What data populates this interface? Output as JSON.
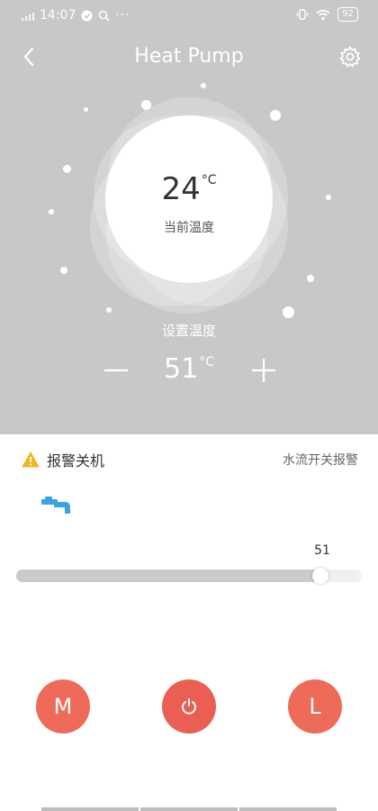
{
  "status_bar": {
    "time": "14:07",
    "battery": "92"
  },
  "header": {
    "title": "Heat Pump"
  },
  "current": {
    "temperature": "24",
    "unit": "°C",
    "label": "当前温度"
  },
  "setpoint": {
    "label": "设置温度",
    "temperature": "51",
    "unit": "°C"
  },
  "alarm": {
    "title": "报警关机",
    "detail": "水流开关报警"
  },
  "slider": {
    "value_label": "51",
    "fill_fraction": 0.88
  },
  "buttons": {
    "mode_label": "M",
    "timer_label": "L"
  },
  "colors": {
    "header_bg": "#c8c8c8",
    "accent_button": "#ee6b5a",
    "warning": "#f2b31d",
    "faucet": "#3aa3e3"
  },
  "icons": {
    "back": "back-chevron-icon",
    "settings": "gear-icon",
    "warning": "warning-icon",
    "faucet": "faucet-icon",
    "power": "power-icon"
  }
}
